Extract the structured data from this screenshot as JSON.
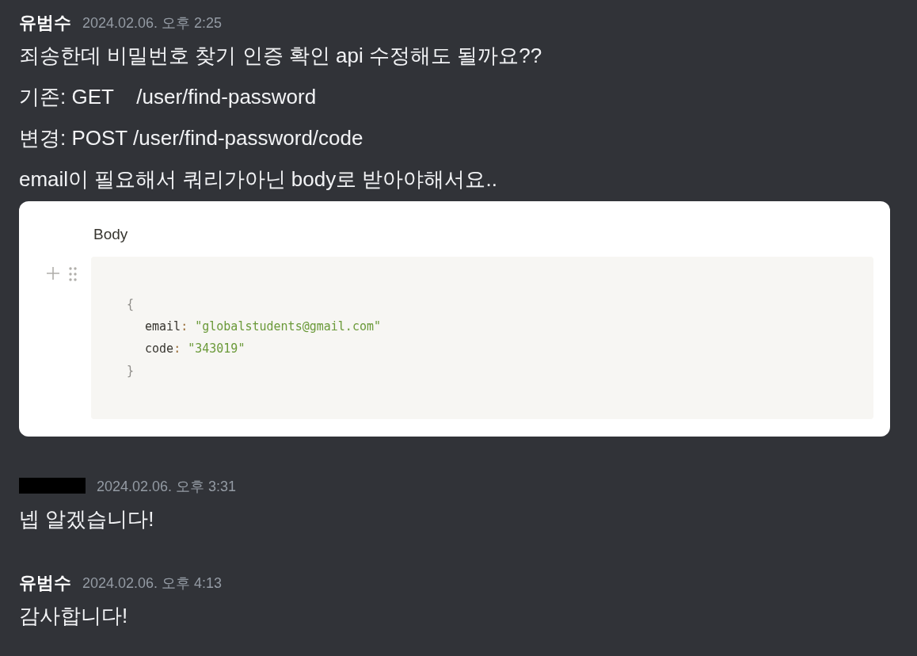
{
  "messages": [
    {
      "author": "유범수",
      "author_redacted": false,
      "timestamp": "2024.02.06. 오후 2:25",
      "lines": [
        "죄송한데 비밀번호 찾기 인증 확인 api 수정해도 될까요??",
        "기존: GET    /user/find-password",
        "변경: POST /user/find-password/code",
        "email이 필요해서 쿼리가아닌 body로 받아야해서요.."
      ],
      "embed": {
        "heading": "Body",
        "code": {
          "open": "{",
          "entries": [
            {
              "key": "email",
              "colon": ":",
              "value": "\"globalstudents@gmail.com\""
            },
            {
              "key": "code",
              "colon": ":",
              "value": "\"343019\""
            }
          ],
          "close": "}"
        }
      }
    },
    {
      "author_redacted": true,
      "timestamp": "2024.02.06. 오후 3:31",
      "lines": [
        "넵 알겠습니다!"
      ]
    },
    {
      "author": "유범수",
      "author_redacted": false,
      "timestamp": "2024.02.06. 오후 4:13",
      "lines": [
        "감사합니다!"
      ]
    }
  ]
}
